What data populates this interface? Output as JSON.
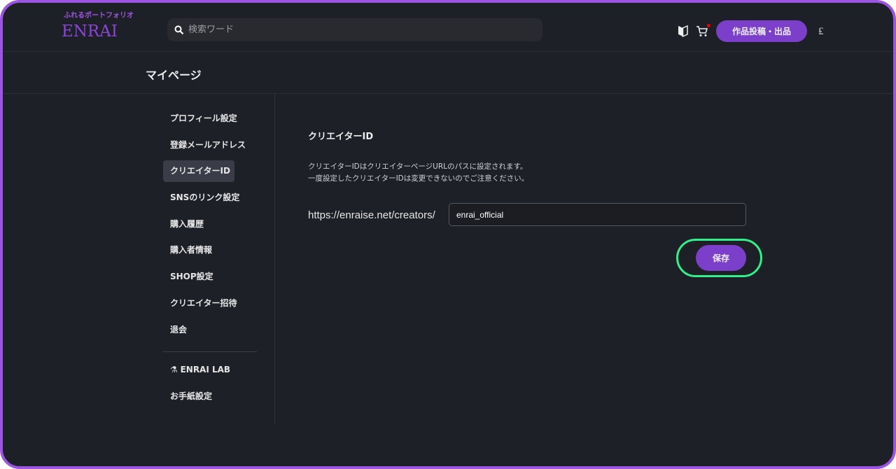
{
  "header": {
    "logo_sub": "ふれるポートフォリオ",
    "logo": "ENRAI",
    "search_placeholder": "検索ワード",
    "post_button": "作品投稿・出品",
    "currency_symbol": "₤"
  },
  "page_title": "マイページ",
  "sidebar": {
    "items": [
      {
        "label": "プロフィール設定"
      },
      {
        "label": "登録メールアドレス"
      },
      {
        "label": "クリエイターID",
        "active": true
      },
      {
        "label": "SNSのリンク設定"
      },
      {
        "label": "購入履歴"
      },
      {
        "label": "購入者情報"
      },
      {
        "label": "SHOP設定"
      },
      {
        "label": "クリエイター招待"
      },
      {
        "label": "退会"
      }
    ],
    "lab": "ENRAI LAB",
    "letter": "お手紙設定"
  },
  "main": {
    "section_title": "クリエイターID",
    "desc1": "クリエイターIDはクリエイターページURLのパスに設定されます。",
    "desc2": "一度設定したクリエイターIDは変更できないのでご注意ください。",
    "url_prefix": "https://enraise.net/creators/",
    "creator_id": "enrai_official",
    "save": "保存"
  },
  "colors": {
    "accent": "#7b3fc9",
    "highlight": "#2ff08a",
    "bg": "#1e2028"
  }
}
